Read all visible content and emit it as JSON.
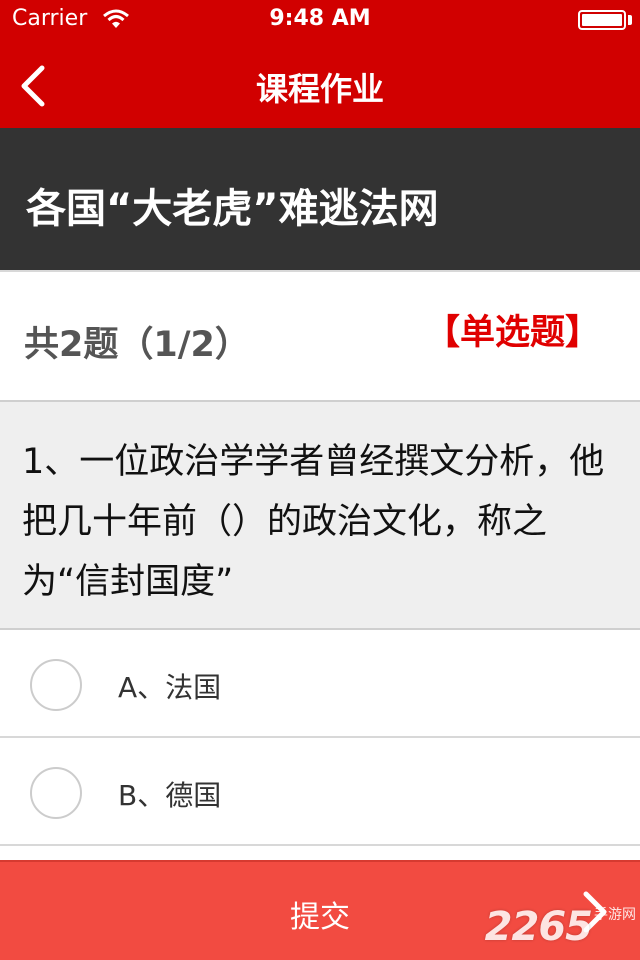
{
  "status_bar": {
    "carrier": "Carrier",
    "time": "9:48 AM",
    "icons": [
      "wifi-icon",
      "battery-icon"
    ]
  },
  "nav": {
    "title": "课程作业",
    "back_icon": "chevron-left-icon"
  },
  "article": {
    "title": "各国“大老虎”难逃法网"
  },
  "quiz": {
    "counter": "共2题（1/2）",
    "type_label": "【单选题】",
    "question": "1、一位政治学学者曾经撰文分析，他把几十年前（）的政治文化，称之为“信封国度”",
    "options": [
      {
        "label": "A、法国",
        "selected": false
      },
      {
        "label": "B、德国",
        "selected": false
      }
    ]
  },
  "footer": {
    "submit_label": "提交",
    "next_icon": "chevron-right-icon"
  },
  "watermark": {
    "big": "2265",
    "small": "手游网"
  },
  "colors": {
    "brand_red": "#d10000",
    "dark_bar": "#333333",
    "submit_bg": "#f24b41",
    "type_red": "#e00000"
  }
}
